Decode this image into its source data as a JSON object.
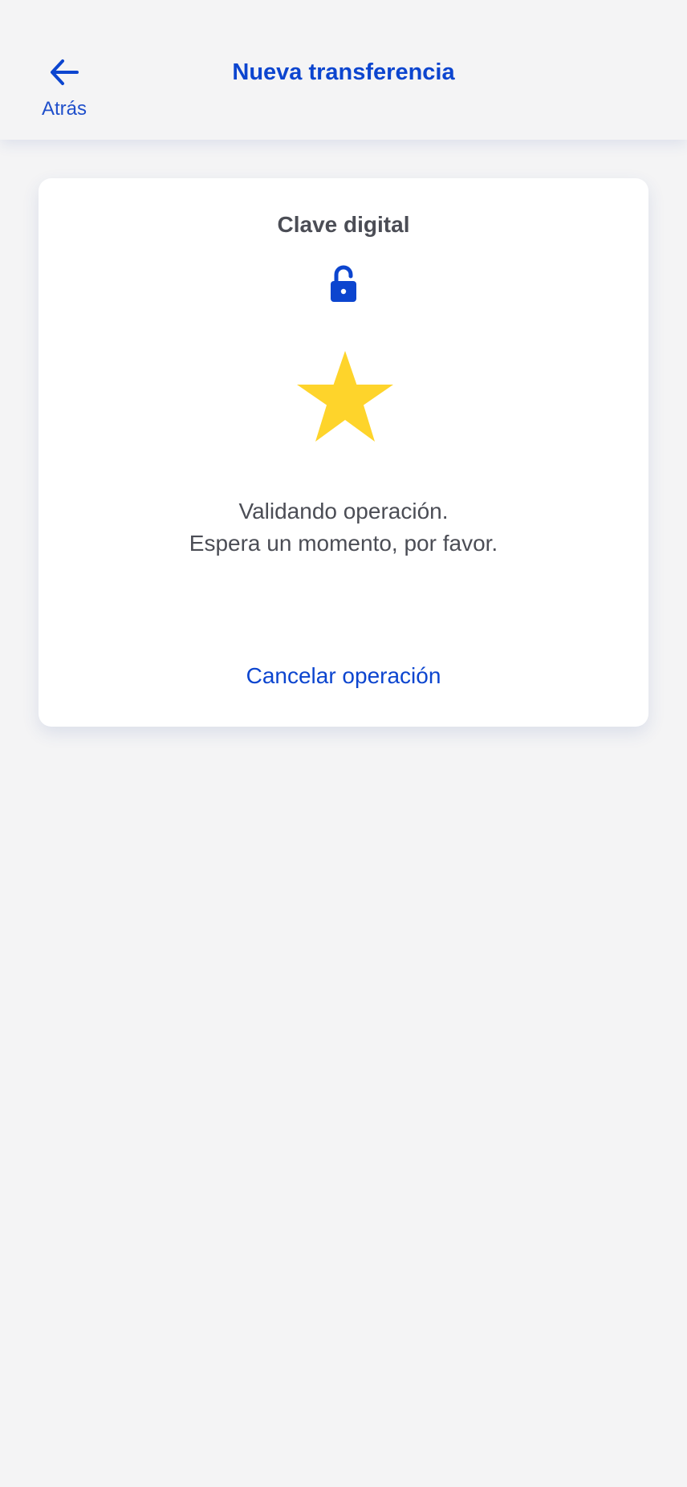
{
  "header": {
    "back_label": "Atrás",
    "title": "Nueva transferencia"
  },
  "card": {
    "title": "Clave digital",
    "status_line_1": "Validando operación.",
    "status_line_2": "Espera un momento, por favor.",
    "cancel_label": "Cancelar operación"
  },
  "icons": {
    "back": "arrow-left-icon",
    "lock": "lock-icon",
    "progress": "star-icon"
  },
  "colors": {
    "accent": "#0c45cf",
    "star": "#fed42b",
    "text": "#4b4d55",
    "background": "#f4f4f5",
    "card": "#ffffff"
  }
}
